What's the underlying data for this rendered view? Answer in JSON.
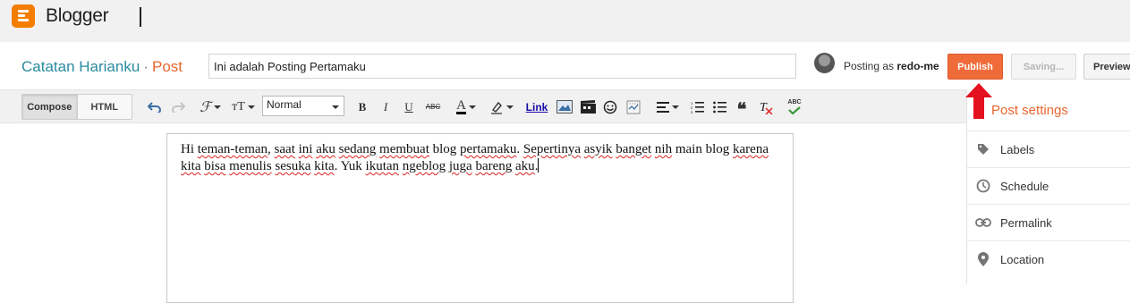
{
  "app": {
    "name": "Blogger"
  },
  "header": {
    "blog_name": "Catatan Harianku",
    "separator": "·",
    "section": "Post",
    "post_title": "Ini adalah Posting Pertamaku",
    "posting_as_prefix": "Posting as",
    "user": "redo-me"
  },
  "actions": {
    "publish": "Publish",
    "saving": "Saving...",
    "preview": "Preview"
  },
  "toolbar": {
    "compose": "Compose",
    "html": "HTML",
    "font_format": "Normal",
    "link": "Link",
    "bold": "B",
    "italic": "I",
    "underline": "U",
    "strikethrough": "ABC",
    "text_color_letter": "A",
    "spellcheck": "ABC"
  },
  "editor": {
    "content_parts": [
      "Hi ",
      "teman-teman",
      ", ",
      "saat",
      " ",
      "ini",
      " ",
      "aku",
      " ",
      "sedang",
      " ",
      "membuat",
      " blog ",
      "pertamaku",
      ". ",
      "Sepertinya",
      " ",
      "asyik",
      " ",
      "banget",
      " ",
      "nih",
      " main blog ",
      "karena",
      " ",
      "kita",
      " ",
      "bisa",
      " ",
      "menulis",
      " ",
      "sesuka",
      " ",
      "kita",
      ". Yuk ",
      "ikutan",
      " ",
      "ngeblog",
      " ",
      "juga",
      " ",
      "bareng",
      " ",
      "aku",
      "."
    ]
  },
  "sidebar": {
    "title": "Post settings",
    "items": [
      {
        "label": "Labels",
        "icon": "tag-icon"
      },
      {
        "label": "Schedule",
        "icon": "clock-icon"
      },
      {
        "label": "Permalink",
        "icon": "link-icon"
      },
      {
        "label": "Location",
        "icon": "location-pin-icon"
      }
    ]
  },
  "colors": {
    "brand": "#f57d00",
    "publish": "#f06b3a",
    "blog_name": "#2a8b9e",
    "accent": "#e8662f",
    "arrow": "#e4111f"
  }
}
